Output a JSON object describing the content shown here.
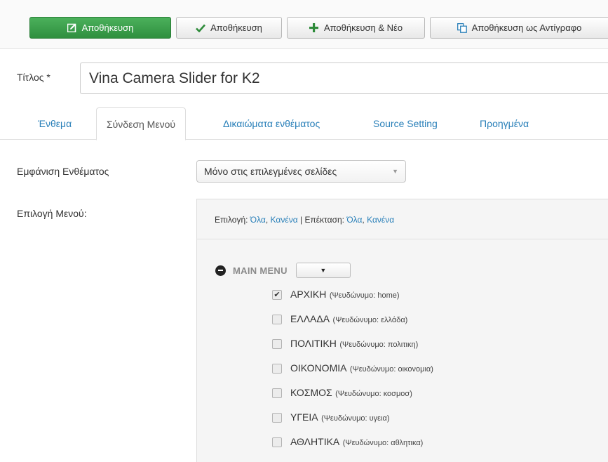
{
  "toolbar": {
    "save_primary": "Αποθήκευση",
    "save": "Αποθήκευση",
    "save_new": "Αποθήκευση & Νέο",
    "save_copy": "Αποθήκευση ως Αντίγραφο",
    "icons": [
      "edit-icon",
      "check-icon",
      "plus-icon",
      "copy-icon"
    ],
    "colors": {
      "primary": "#3ea04e",
      "plus": "#2e8b3a",
      "check": "#2e8b3a",
      "copy": "#2a80b9"
    }
  },
  "title": {
    "label": "Τίτλος",
    "required_mark": "*",
    "value": "Vina Camera Slider for K2"
  },
  "tabs": [
    {
      "label": "Ένθεμα",
      "active": false
    },
    {
      "label": "Σύνδεση Μενού",
      "active": true
    },
    {
      "label": "Δικαιώματα ενθέματος",
      "active": false
    },
    {
      "label": "Source Setting",
      "active": false
    },
    {
      "label": "Προηγμένα",
      "active": false
    }
  ],
  "module_display": {
    "label": "Εμφάνιση Ενθέματος",
    "selected": "Μόνο στις επιλεγμένες σελίδες"
  },
  "menu_selection": {
    "label": "Επιλογή Μενού:",
    "selection_label": "Επιλογή:",
    "expand_label": "Επέκταση:",
    "all": "Όλα",
    "none": "Κανένα",
    "comma": ",",
    "divider": "|",
    "menu_title": "MAIN MENU",
    "items": [
      {
        "name": "ΑΡΧΙΚΗ",
        "alias": "(Ψευδώνυμο: home)",
        "checked": true
      },
      {
        "name": "ΕΛΛΑΔΑ",
        "alias": "(Ψευδώνυμο: ελλάδα)",
        "checked": false
      },
      {
        "name": "ΠΟΛΙΤΙΚΗ",
        "alias": "(Ψευδώνυμο: πολιτικη)",
        "checked": false
      },
      {
        "name": "ΟΙΚΟΝΟΜΙΑ",
        "alias": "(Ψευδώνυμο: οικονομια)",
        "checked": false
      },
      {
        "name": "ΚΟΣΜΟΣ",
        "alias": "(Ψευδώνυμο: κοσμοσ)",
        "checked": false
      },
      {
        "name": "ΥΓΕΙΑ",
        "alias": "(Ψευδώνυμο: υγεια)",
        "checked": false
      },
      {
        "name": "ΑΘΛΗΤΙΚΑ",
        "alias": "(Ψευδώνυμο: αθλητικα)",
        "checked": false
      }
    ]
  }
}
